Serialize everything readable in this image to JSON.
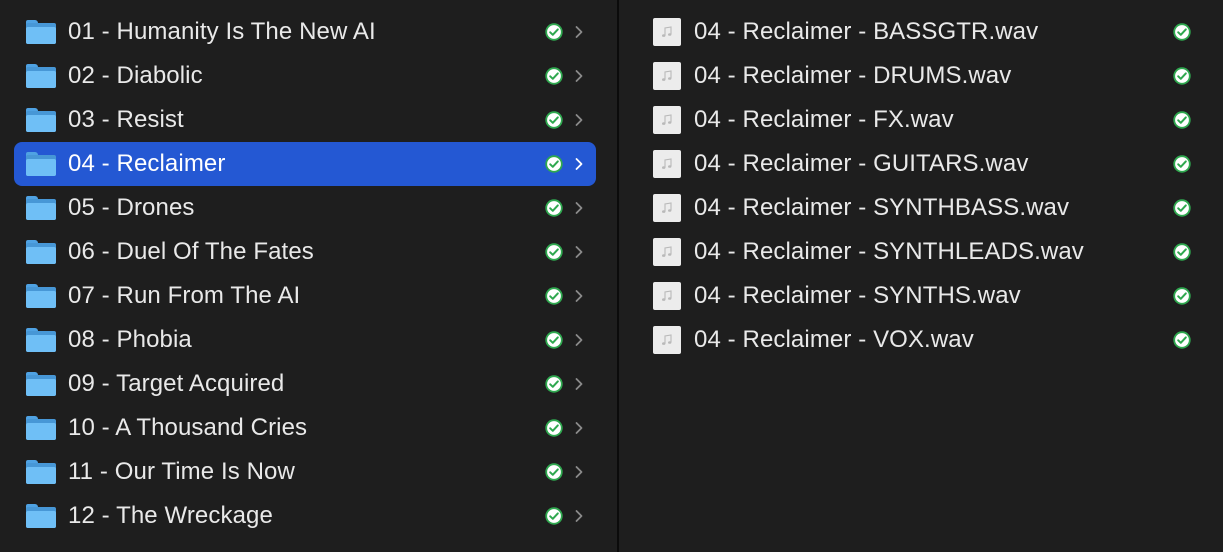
{
  "left_column": {
    "items": [
      {
        "label": "01 - Humanity Is The New AI",
        "selected": false
      },
      {
        "label": "02 - Diabolic",
        "selected": false
      },
      {
        "label": "03 - Resist",
        "selected": false
      },
      {
        "label": "04 - Reclaimer",
        "selected": true
      },
      {
        "label": "05 - Drones",
        "selected": false
      },
      {
        "label": "06 - Duel Of The Fates",
        "selected": false
      },
      {
        "label": "07 - Run From The AI",
        "selected": false
      },
      {
        "label": "08 - Phobia",
        "selected": false
      },
      {
        "label": "09 - Target Acquired",
        "selected": false
      },
      {
        "label": "10 - A Thousand Cries",
        "selected": false
      },
      {
        "label": "11 - Our Time Is Now",
        "selected": false
      },
      {
        "label": "12 - The Wreckage",
        "selected": false
      }
    ]
  },
  "right_column": {
    "items": [
      {
        "label": "04 - Reclaimer - BASSGTR.wav"
      },
      {
        "label": "04 - Reclaimer - DRUMS.wav"
      },
      {
        "label": "04 - Reclaimer - FX.wav"
      },
      {
        "label": "04 - Reclaimer - GUITARS.wav"
      },
      {
        "label": "04 - Reclaimer - SYNTHBASS.wav"
      },
      {
        "label": "04 - Reclaimer - SYNTHLEADS.wav"
      },
      {
        "label": "04 - Reclaimer - SYNTHS.wav"
      },
      {
        "label": "04 - Reclaimer - VOX.wav"
      }
    ]
  },
  "icons": {
    "folder": "folder-icon",
    "audio_file": "audio-file-icon",
    "sync_status": "synced-check-icon",
    "disclosure": "chevron-right-icon"
  },
  "colors": {
    "background": "#1e1e1e",
    "selection": "#2458d3",
    "status_ok": "#2fa84f",
    "folder": "#6fbff6"
  }
}
